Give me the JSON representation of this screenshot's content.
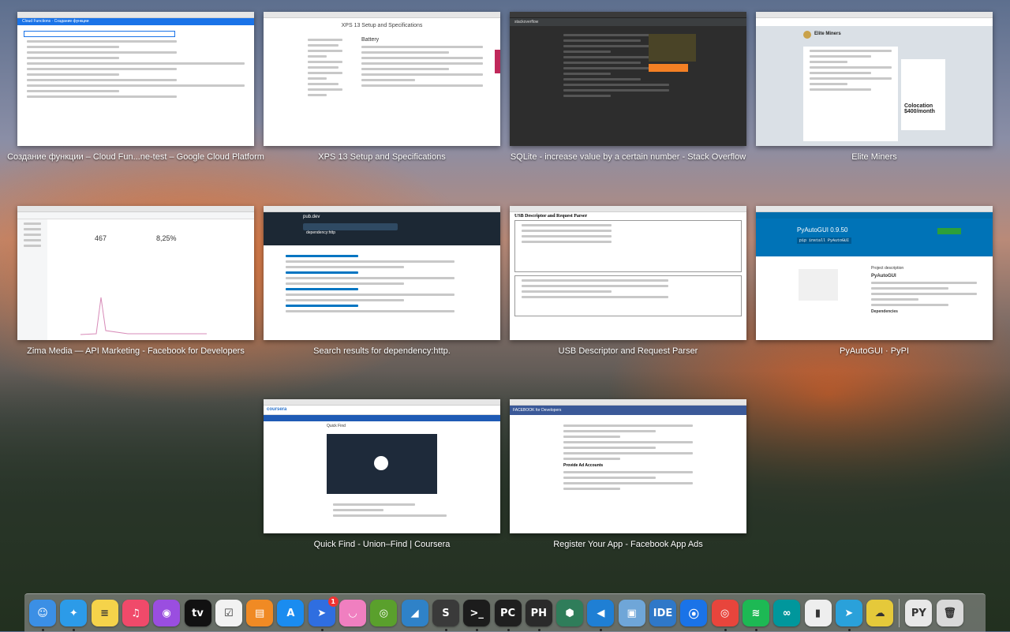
{
  "windows": [
    {
      "title": "Создание функции – Cloud Fun...ne-test – Google Cloud Platform"
    },
    {
      "title": "XPS 13 Setup and Specifications"
    },
    {
      "title": "SQLite - increase value by a certain number - Stack Overflow"
    },
    {
      "title": "Elite Miners"
    },
    {
      "title": "Zima Media — API Marketing - Facebook for Developers"
    },
    {
      "title": "Search results for dependency:http."
    },
    {
      "title": "USB Descriptor and Request Parser"
    },
    {
      "title": "PyAutoGUI · PyPI"
    },
    {
      "title": "Quick Find - Union–Find | Coursera"
    },
    {
      "title": "Register Your App - Facebook App Ads"
    }
  ],
  "thumbs": {
    "gcp_header": "Cloud Functions",
    "gcp_page": "Создание функции",
    "xps_title": "XPS 13 Setup and Specifications",
    "xps_section": "Battery",
    "so_logo": "stackoverflow",
    "reddit_title": "Elite Miners",
    "reddit_ad": "Colocation $400/month",
    "fb_stat1": "467",
    "fb_stat2": "8,25%",
    "pubdev_logo": "pub.dev",
    "pubdev_query": "dependency:http",
    "usb_title": "USB Descriptor and Request Parser",
    "pypi_title": "PyAutoGUI 0.9.50",
    "pypi_install": "pip install PyAutoGUI",
    "pypi_desc_title": "Project description",
    "pypi_h1": "PyAutoGUI",
    "pypi_dep": "Dependencies",
    "coursera_logo": "coursera",
    "coursera_lesson": "Quick Find",
    "fb_app_header": "FACEBOOK for Developers",
    "fb_app_section": "Provide Ad Accounts"
  },
  "dock": {
    "apps": [
      {
        "name": "Finder",
        "icon": "finder-icon",
        "glyph": "☺",
        "color": "#3b8fe5",
        "running": true
      },
      {
        "name": "Safari",
        "icon": "safari-icon",
        "glyph": "✦",
        "color": "#2c9be8",
        "running": true
      },
      {
        "name": "Notes",
        "icon": "notes-icon",
        "glyph": "≡",
        "color": "#f5d34a",
        "running": false
      },
      {
        "name": "Music",
        "icon": "music-icon",
        "glyph": "♫",
        "color": "#f04a6a",
        "running": false
      },
      {
        "name": "Podcasts",
        "icon": "podcasts-icon",
        "glyph": "◉",
        "color": "#9a4ee0",
        "running": false
      },
      {
        "name": "TV",
        "icon": "tv-icon",
        "glyph": "tv",
        "color": "#111111",
        "running": false
      },
      {
        "name": "Reminders",
        "icon": "reminders-icon",
        "glyph": "☑",
        "color": "#f2f2f2",
        "running": false
      },
      {
        "name": "Books",
        "icon": "books-icon",
        "glyph": "▤",
        "color": "#f08a24",
        "running": false
      },
      {
        "name": "App Store",
        "icon": "app-store-icon",
        "glyph": "A",
        "color": "#1a8cf0",
        "running": false
      },
      {
        "name": "Spark",
        "icon": "spark-mail-icon",
        "glyph": "➤",
        "color": "#2f6ee0",
        "running": true,
        "badge": "1"
      },
      {
        "name": "Pastebot",
        "icon": "pastebot-icon",
        "glyph": "◡",
        "color": "#f07fc0",
        "running": false
      },
      {
        "name": "NVIDIA",
        "icon": "nvidia-icon",
        "glyph": "◎",
        "color": "#5aa02c",
        "running": false
      },
      {
        "name": "Wireshark",
        "icon": "wireshark-icon",
        "glyph": "◢",
        "color": "#2f82c8",
        "running": false
      },
      {
        "name": "Sublime Text",
        "icon": "sublime-text-icon",
        "glyph": "S",
        "color": "#3a3a3a",
        "running": true
      },
      {
        "name": "Terminal",
        "icon": "terminal-icon",
        "glyph": ">_",
        "color": "#1c1c1c",
        "running": true
      },
      {
        "name": "PyCharm",
        "icon": "pycharm-icon",
        "glyph": "PC",
        "color": "#1f1f1f",
        "running": true
      },
      {
        "name": "Phoenix",
        "icon": "phoenix-icon",
        "glyph": "PH",
        "color": "#2a2a2a",
        "running": true
      },
      {
        "name": "Android Studio",
        "icon": "android-studio-icon",
        "glyph": "⬢",
        "color": "#2f7d5a",
        "running": false
      },
      {
        "name": "VS Code",
        "icon": "vscode-icon",
        "glyph": "◀",
        "color": "#1f7fd4",
        "running": true
      },
      {
        "name": "Preview",
        "icon": "preview-icon",
        "glyph": "▣",
        "color": "#6fa6d8",
        "running": false
      },
      {
        "name": "IDE",
        "icon": "ide-icon",
        "glyph": "IDE",
        "color": "#2f78c8",
        "running": false
      },
      {
        "name": "Maps",
        "icon": "maps-pin-icon",
        "glyph": "⦿",
        "color": "#1a73e8",
        "running": false
      },
      {
        "name": "Chrome",
        "icon": "chrome-icon",
        "glyph": "◎",
        "color": "#e8453c",
        "running": true
      },
      {
        "name": "Spotify",
        "icon": "spotify-icon",
        "glyph": "≋",
        "color": "#1db954",
        "running": true
      },
      {
        "name": "Arduino",
        "icon": "arduino-icon",
        "glyph": "∞",
        "color": "#00979c",
        "running": false
      },
      {
        "name": "Charts",
        "icon": "charts-icon",
        "glyph": "▮",
        "color": "#eeeeee",
        "running": false
      },
      {
        "name": "Telegram",
        "icon": "telegram-icon",
        "glyph": "➤",
        "color": "#2aa1da",
        "running": true
      },
      {
        "name": "Clouds",
        "icon": "clouds-icon",
        "glyph": "☁",
        "color": "#e5c93a",
        "running": false
      }
    ],
    "files": [
      {
        "name": "Python Folder",
        "icon": "python-folder-icon",
        "glyph": "PY",
        "color": "#e8e8e8"
      },
      {
        "name": "Trash",
        "icon": "trash-icon",
        "glyph": "🗑",
        "color": "#d9d9d9"
      }
    ]
  }
}
